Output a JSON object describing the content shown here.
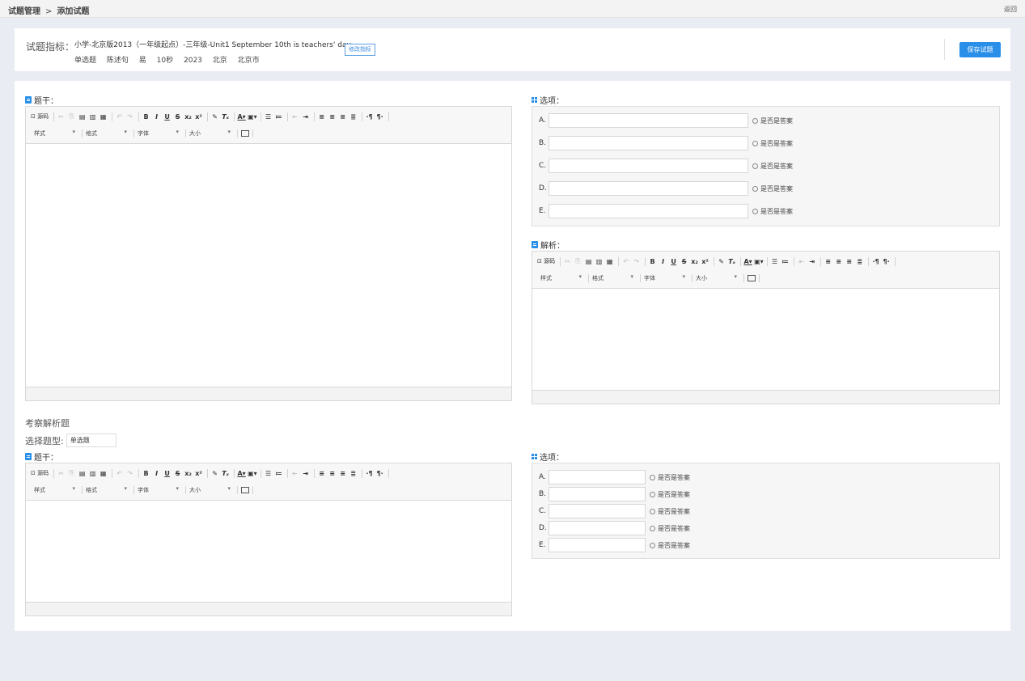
{
  "breadcrumb": {
    "root": "试题管理",
    "separator": ">",
    "current": "添加试题"
  },
  "back_label": "返回",
  "meta": {
    "label": "试题指标：",
    "title": "小学-北京版2013（一年级起点）-三年级-Unit1 September 10th is teachers' day.",
    "tags": [
      "单选题",
      "陈述句",
      "易",
      "10秒",
      "2023",
      "北京",
      "北京市"
    ],
    "edit_button": "修改指标",
    "save_button": "保存试题"
  },
  "editor_toolbar": {
    "source_label": "源码",
    "style_label": "样式",
    "format_label": "格式",
    "font_label": "字体",
    "size_label": "大小"
  },
  "section1": {
    "stem_title": "题干：",
    "options_title": "选项：",
    "analysis_title": "解析：",
    "options": [
      {
        "letter": "A.",
        "value": "",
        "answer_label": "是否是答案"
      },
      {
        "letter": "B.",
        "value": "",
        "answer_label": "是否是答案"
      },
      {
        "letter": "C.",
        "value": "",
        "answer_label": "是否是答案"
      },
      {
        "letter": "D.",
        "value": "",
        "answer_label": "是否是答案"
      },
      {
        "letter": "E.",
        "value": "",
        "answer_label": "是否是答案"
      }
    ]
  },
  "section2": {
    "title": "考察解析题",
    "type_label": "选择题型:",
    "type_value": "单选题",
    "stem_title": "题干：",
    "options_title": "选项：",
    "options": [
      {
        "letter": "A.",
        "value": "",
        "answer_label": "是否是答案"
      },
      {
        "letter": "B.",
        "value": "",
        "answer_label": "是否是答案"
      },
      {
        "letter": "C.",
        "value": "",
        "answer_label": "是否是答案"
      },
      {
        "letter": "D.",
        "value": "",
        "answer_label": "是否是答案"
      },
      {
        "letter": "E.",
        "value": "",
        "answer_label": "是否是答案"
      }
    ]
  },
  "colors": {
    "accent": "#2a8fe8",
    "page_bg": "#e9ecf3"
  }
}
